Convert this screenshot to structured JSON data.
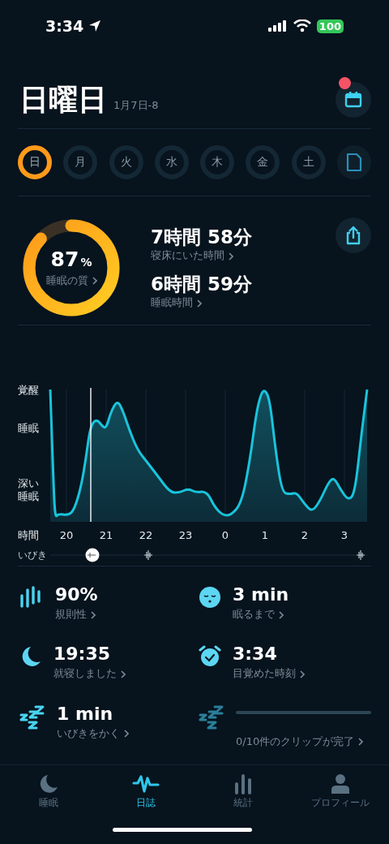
{
  "status_bar": {
    "time": "3:34",
    "battery": "100"
  },
  "header": {
    "title": "日曜日",
    "date": "1月7日-8",
    "calendar_notification": true
  },
  "days": [
    {
      "label": "日",
      "selected": true
    },
    {
      "label": "月",
      "selected": false
    },
    {
      "label": "火",
      "selected": false
    },
    {
      "label": "水",
      "selected": false
    },
    {
      "label": "木",
      "selected": false
    },
    {
      "label": "金",
      "selected": false
    },
    {
      "label": "土",
      "selected": false
    }
  ],
  "score": {
    "value": "87",
    "unit": "%",
    "label": "睡眠の質",
    "level": 0.87
  },
  "durations": [
    {
      "value": "7時間 58分",
      "label": "寝床にいた時間"
    },
    {
      "value": "6時間 59分",
      "label": "睡眠時間"
    }
  ],
  "chart": {
    "y_labels": [
      [
        "覚醒"
      ],
      [
        "睡眠"
      ],
      [
        "深い",
        "睡眠"
      ]
    ],
    "x_axis_label": "時間",
    "x_labels": [
      "20",
      "21",
      "22",
      "23",
      "0",
      "1",
      "2",
      "3"
    ],
    "snore_label": "いびき"
  },
  "metrics": [
    {
      "kind": "stat",
      "value": "90%",
      "label": "規則性"
    },
    {
      "kind": "stat",
      "value": "3 min",
      "label": "眠るまで"
    },
    {
      "kind": "stat",
      "value": "19:35",
      "label": "就寝しました"
    },
    {
      "kind": "stat",
      "value": "3:34",
      "label": "目覚めた時刻"
    },
    {
      "kind": "stat",
      "value": "1 min",
      "label": "いびきをかく"
    },
    {
      "kind": "progress",
      "level": 0,
      "label": "0/10件のクリップが完了"
    }
  ],
  "nav": [
    {
      "label": "睡眠",
      "selected": false
    },
    {
      "label": "日誌",
      "selected": true
    },
    {
      "label": "統計",
      "selected": false
    },
    {
      "label": "プロフィール",
      "selected": false
    }
  ]
}
